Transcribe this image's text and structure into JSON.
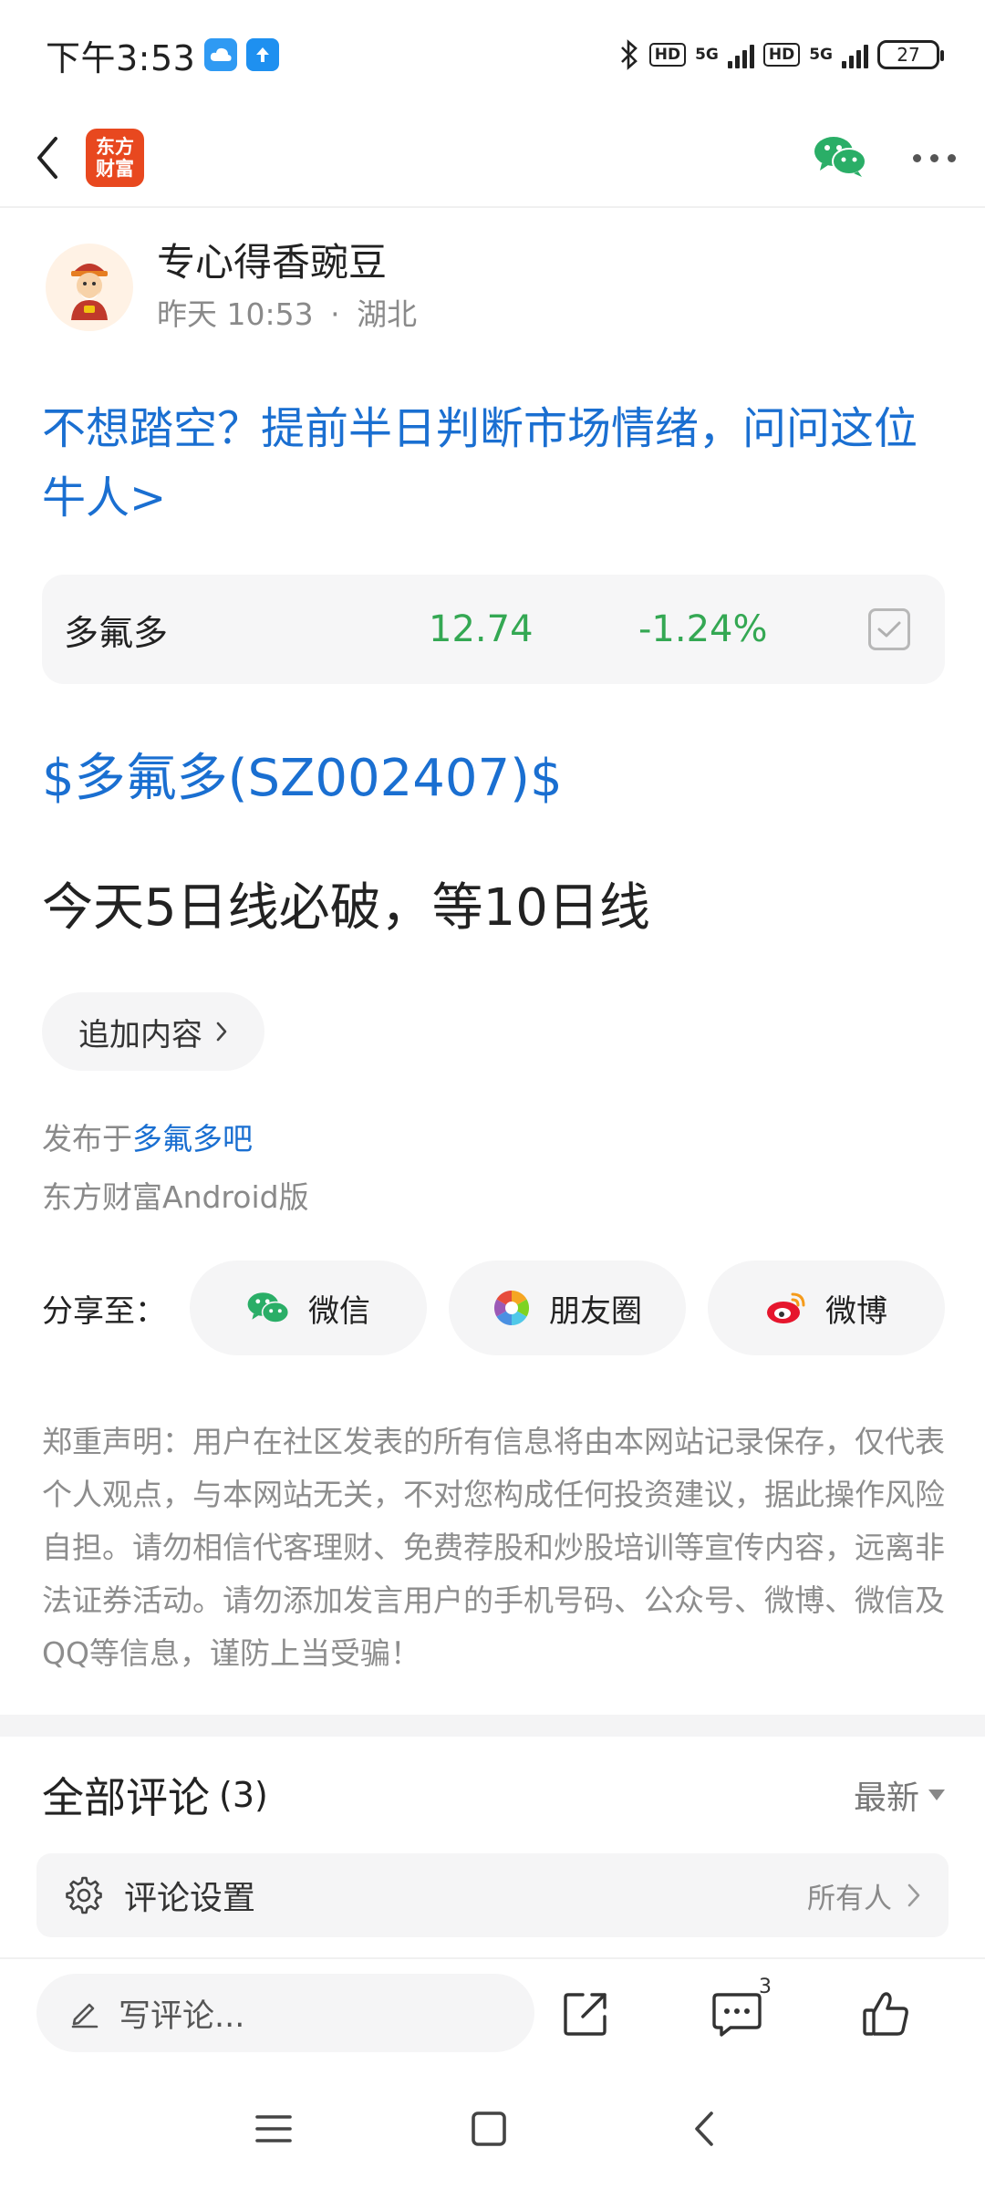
{
  "status_bar": {
    "time": "下午3:53",
    "battery": "27",
    "network_1": "5G",
    "network_2": "5G",
    "hd_1": "HD",
    "hd_2": "HD"
  },
  "header": {
    "logo_line1": "东方",
    "logo_line2": "财富",
    "accent": "#e8481f"
  },
  "author": {
    "name": "专心得香豌豆",
    "time": "昨天 10:53",
    "location": "湖北"
  },
  "promo_text": "不想踏空？提前半日判断市场情绪，问问这位牛人>",
  "stock": {
    "name": "多氟多",
    "price": "12.74",
    "change": "-1.24%",
    "color": "#34a853"
  },
  "post": {
    "stock_tag": "$多氟多(SZ002407)$",
    "body": "今天5日线必破，等10日线",
    "add_content_label": "追加内容",
    "posted_in_prefix": "发布于",
    "posted_in_bar": "多氟多吧",
    "platform": "东方财富Android版"
  },
  "share": {
    "label": "分享至：",
    "wechat": "微信",
    "moments": "朋友圈",
    "weibo": "微博"
  },
  "disclaimer": "郑重声明：用户在社区发表的所有信息将由本网站记录保存，仅代表个人观点，与本网站无关，不对您构成任何投资建议，据此操作风险自担。请勿相信代客理财、免费荐股和炒股培训等宣传内容，远离非法证券活动。请勿添加发言用户的手机号码、公众号、微博、微信及QQ等信息，谨防上当受骗！",
  "comments": {
    "title": "全部评论",
    "count": "(3)",
    "sort": "最新",
    "settings_label": "评论设置",
    "settings_value": "所有人"
  },
  "bottom_bar": {
    "input_placeholder": "写评论...",
    "comment_badge": "3"
  },
  "colors": {
    "link_blue": "#1a6fd1",
    "wechat_green": "#2aae67"
  }
}
